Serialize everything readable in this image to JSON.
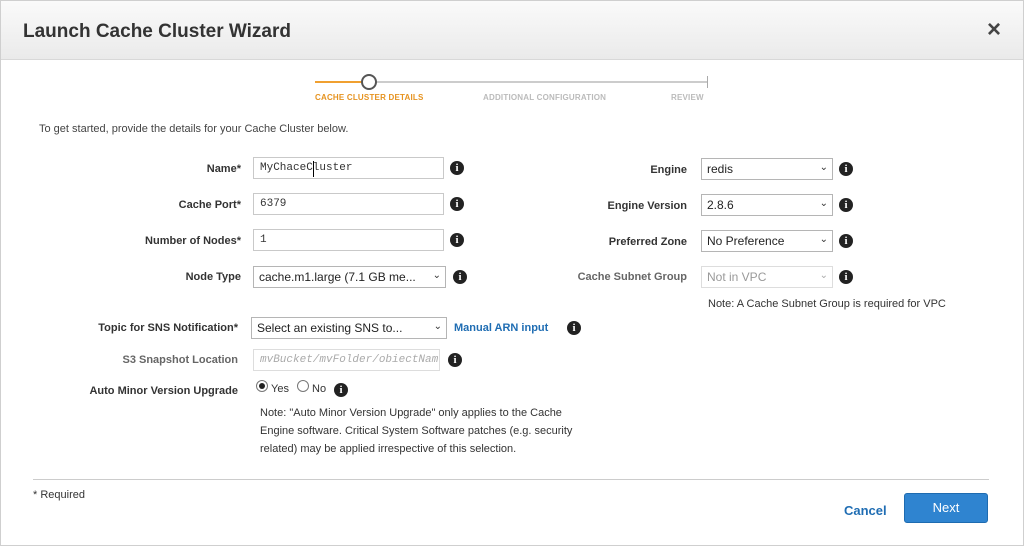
{
  "header": {
    "title": "Launch Cache Cluster Wizard",
    "close_icon": "×"
  },
  "steps": [
    {
      "label": "CACHE CLUSTER DETAILS",
      "active": true
    },
    {
      "label": "ADDITIONAL CONFIGURATION",
      "active": false
    },
    {
      "label": "REVIEW",
      "active": false
    }
  ],
  "intro": "To get started, provide the details for your Cache Cluster below.",
  "left": {
    "name": {
      "label": "Name*",
      "value": "MyChaceCluster"
    },
    "cache_port": {
      "label": "Cache Port*",
      "value": "6379"
    },
    "nodes": {
      "label": "Number of Nodes*",
      "value": "1"
    },
    "node_type": {
      "label": "Node Type",
      "value": "cache.m1.large (7.1 GB me..."
    }
  },
  "right": {
    "engine": {
      "label": "Engine",
      "value": "redis"
    },
    "engine_version": {
      "label": "Engine Version",
      "value": "2.8.6"
    },
    "zone": {
      "label": "Preferred Zone",
      "value": "No Preference"
    },
    "subnet": {
      "label": "Cache Subnet Group",
      "value": "Not in VPC",
      "note": "Note: A Cache Subnet Group is required for VPC"
    }
  },
  "sns": {
    "label": "Topic for SNS Notification*",
    "value": "Select an existing SNS to...",
    "link": "Manual ARN input"
  },
  "s3": {
    "label": "S3 Snapshot Location",
    "placeholder": "mvBucket/mvFolder/obiectNam"
  },
  "auto_minor": {
    "label": "Auto Minor Version Upgrade",
    "yes": "Yes",
    "no": "No",
    "selected": "Yes",
    "note_line1": "Note: \"Auto Minor Version Upgrade\" only applies to the Cache",
    "note_line2": "Engine software. Critical System Software patches (e.g. security",
    "note_line3": "related) may be applied irrespective of this selection."
  },
  "footer": {
    "required": "* Required",
    "cancel": "Cancel",
    "next": "Next"
  },
  "icons": {
    "info": "i",
    "arrow": "⌄"
  },
  "colors": {
    "accent": "#e69320",
    "link": "#1f6db3",
    "primary_button": "#2f84d0"
  }
}
